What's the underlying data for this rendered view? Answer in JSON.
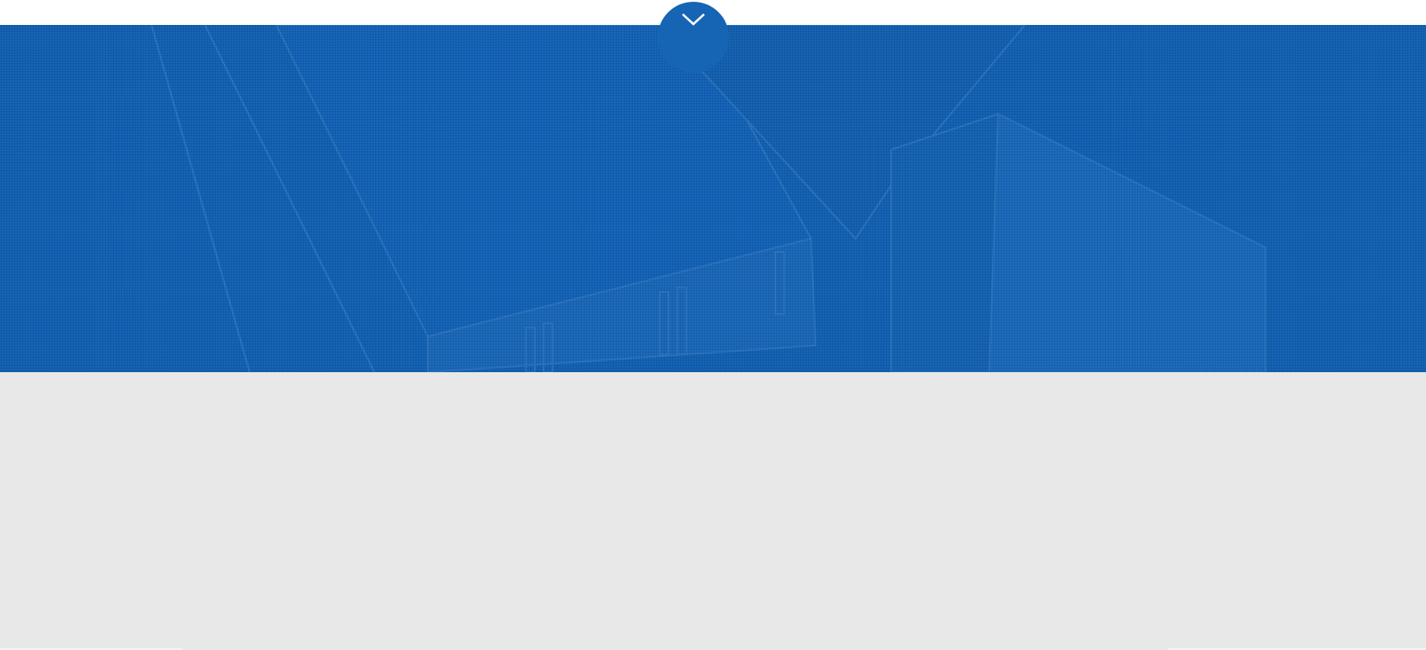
{
  "colors": {
    "banner": "#1664b4",
    "background": "#e8e8e8",
    "topbar": "#ffffff",
    "chevron": "#ffffff"
  },
  "icons": {
    "toggle": "chevron-down-icon"
  }
}
